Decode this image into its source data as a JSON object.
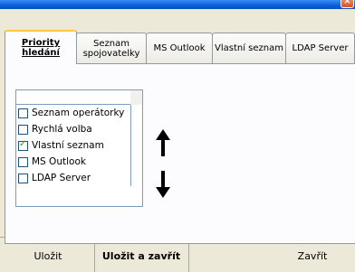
{
  "window": {
    "close_glyph": "×"
  },
  "tabs": [
    {
      "label_line1": "Priority",
      "label_line2": "hledání"
    },
    {
      "label_line1": "Seznam",
      "label_line2": "spojovatelky"
    },
    {
      "label_line1": "MS Outlook",
      "label_line2": ""
    },
    {
      "label_line1": "Vlastní seznam",
      "label_line2": ""
    },
    {
      "label_line1": "LDAP Server",
      "label_line2": ""
    }
  ],
  "list": {
    "items": [
      {
        "label": "Seznam operátorky",
        "checked": false
      },
      {
        "label": "Rychlá volba",
        "checked": false
      },
      {
        "label": "Vlastní seznam",
        "checked": true
      },
      {
        "label": "MS Outlook",
        "checked": false
      },
      {
        "label": "LDAP Server",
        "checked": false
      }
    ]
  },
  "buttons": {
    "save": "Uložit",
    "save_close": "Uložit a zavřít",
    "close": "Zavřít"
  }
}
